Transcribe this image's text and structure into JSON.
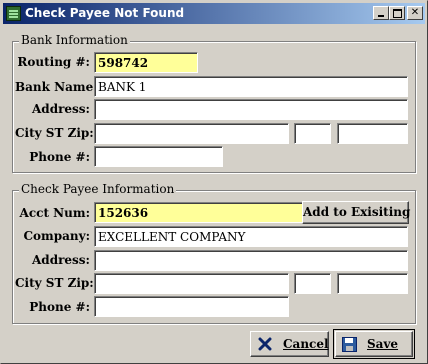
{
  "window": {
    "title": "Check Payee Not Found"
  },
  "bank": {
    "section_title": "Bank Information",
    "routing_label": "Routing #:",
    "routing_value": "598742",
    "name_label": "Bank Name:",
    "name_value": "BANK 1",
    "address_label": "Address:",
    "address_value": "",
    "city_label": "City ST Zip:",
    "city_value": "",
    "state_value": "",
    "zip_value": "",
    "phone_label": "Phone #:",
    "phone_value": ""
  },
  "payee": {
    "section_title": "Check Payee Information",
    "acct_label": "Acct Num:",
    "acct_value": "152636",
    "add_button": "Add to Exisiting",
    "company_label": "Company:",
    "company_value": "EXCELLENT COMPANY",
    "address_label": "Address:",
    "address_value": "",
    "city_label": "City ST Zip:",
    "city_value": "",
    "state_value": "",
    "zip_value": "",
    "phone_label": "Phone #:",
    "phone_value": ""
  },
  "actions": {
    "cancel_label": "Cancel",
    "save_label": "Save"
  },
  "icons": {
    "app": "app-icon",
    "cancel": "x-icon",
    "save": "floppy-disk-icon"
  },
  "colors": {
    "title_start": "#0a246a",
    "title_end": "#a6caf0",
    "highlight_field": "#ffff99",
    "cancel_icon": "#0a246a"
  }
}
